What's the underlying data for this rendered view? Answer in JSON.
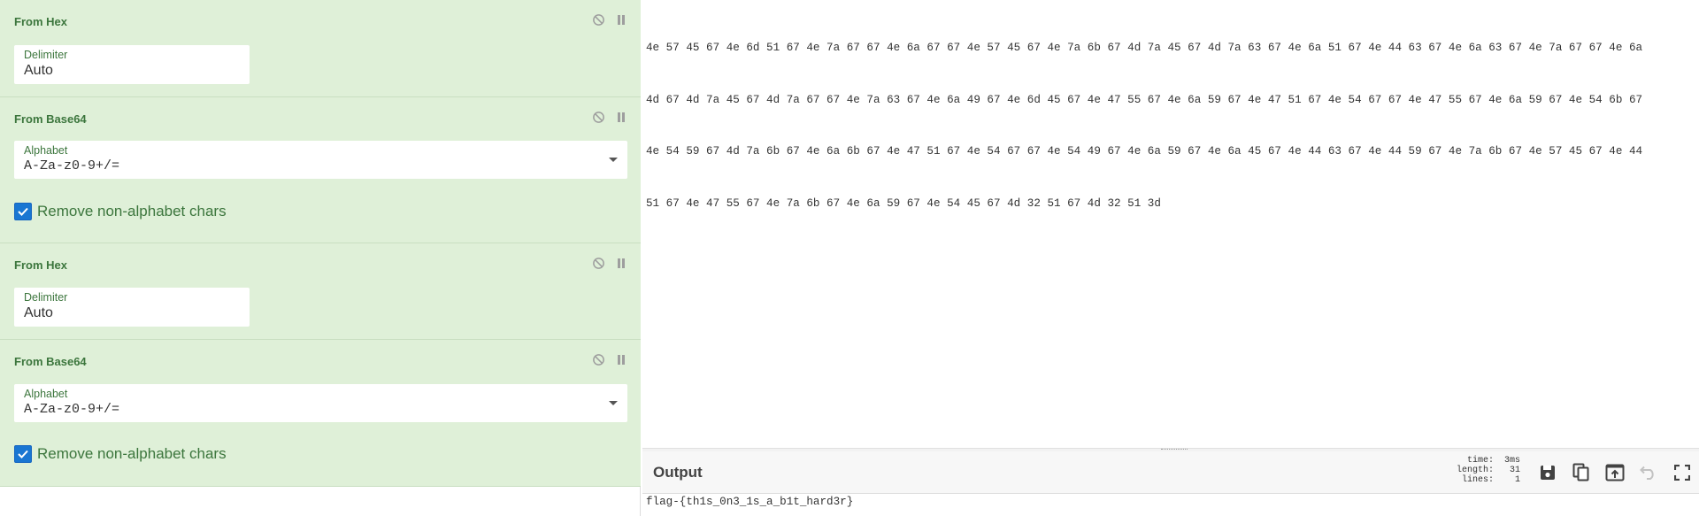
{
  "recipe": {
    "operations": [
      {
        "name": "From Hex",
        "argument_label": "Delimiter",
        "argument_value": "Auto"
      },
      {
        "name": "From Base64",
        "argument_label": "Alphabet",
        "argument_value": "A-Za-z0-9+/=",
        "checkbox_label": "Remove non-alphabet chars",
        "checkbox_checked": true
      },
      {
        "name": "From Hex",
        "argument_label": "Delimiter",
        "argument_value": "Auto"
      },
      {
        "name": "From Base64",
        "argument_label": "Alphabet",
        "argument_value": "A-Za-z0-9+/=",
        "checkbox_label": "Remove non-alphabet chars",
        "checkbox_checked": true
      }
    ],
    "icons": {
      "disable": "disable-icon",
      "pause": "pause-icon",
      "dropdown": "dropdown-arrow-icon",
      "check": "check-icon"
    }
  },
  "input": {
    "lines": [
      "4e 57 45 67 4e 6d 51 67 4e 7a 67 67 4e 6a 67 67 4e 57 45 67 4e 7a 6b 67 4d 7a 45 67 4d 7a 63 67 4e 6a 51 67 4e 44 63 67 4e 6a 63 67 4e 7a 67 67 4e 6a",
      "4d 67 4d 7a 45 67 4d 7a 67 67 4e 7a 63 67 4e 6a 49 67 4e 6d 45 67 4e 47 55 67 4e 6a 59 67 4e 47 51 67 4e 54 67 67 4e 47 55 67 4e 6a 59 67 4e 54 6b 67",
      "4e 54 59 67 4d 7a 6b 67 4e 6a 6b 67 4e 47 51 67 4e 54 67 67 4e 54 49 67 4e 6a 59 67 4e 6a 45 67 4e 44 63 67 4e 44 59 67 4e 7a 6b 67 4e 57 45 67 4e 44",
      "51 67 4e 47 55 67 4e 7a 6b 67 4e 6a 59 67 4e 54 45 67 4d 32 51 67 4d 32 51 3d"
    ]
  },
  "output": {
    "title": "Output",
    "stats": [
      {
        "key": "time:",
        "value": "3ms"
      },
      {
        "key": "length:",
        "value": "31"
      },
      {
        "key": "lines:",
        "value": "1"
      }
    ],
    "text": "flag-{th1s_0n3_1s_a_b1t_hard3r}",
    "buttons": [
      "save-icon",
      "copy-icon",
      "replace-input-icon",
      "undo-icon",
      "fullscreen-icon"
    ]
  },
  "colors": {
    "op_background": "#dff0d8",
    "op_text": "#3c763d",
    "checkbox": "#1976d2"
  }
}
